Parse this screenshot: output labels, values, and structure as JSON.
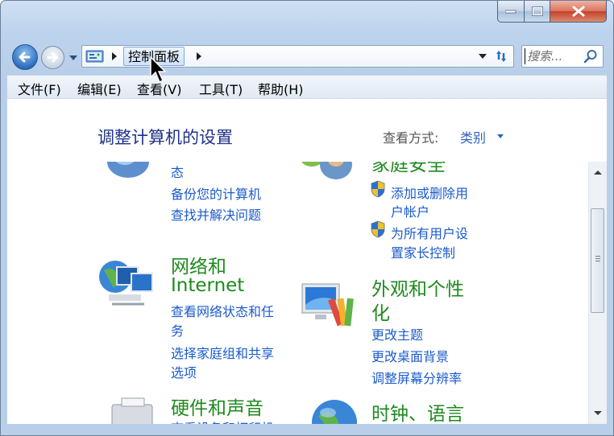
{
  "window": {
    "caption_buttons": [
      "minimize-icon",
      "maximize-icon",
      "close-icon"
    ]
  },
  "address": {
    "breadcrumb": "控制面板",
    "icons": [
      "back-icon",
      "forward-icon",
      "control-panel-icon",
      "refresh-icon"
    ]
  },
  "search": {
    "placeholder": "搜索..."
  },
  "menu": [
    "文件(F)",
    "编辑(E)",
    "查看(V)",
    "工具(T)",
    "帮助(H)"
  ],
  "page": {
    "heading": "调整计算机的设置",
    "view_by_label": "查看方式:",
    "view_by_value": "类别"
  },
  "categories": {
    "system": {
      "links": [
        "态",
        "备份您的计算机",
        "查找并解决问题"
      ]
    },
    "users": {
      "partial_title": "家庭安全",
      "links": [
        "添加或删除用",
        "户帐户",
        "为所有用户设",
        "置家长控制"
      ]
    },
    "network": {
      "title_line1": "网络和",
      "title_line2": "Internet",
      "links": [
        "查看网络状态和任",
        "务",
        "选择家庭组和共享",
        "选项"
      ]
    },
    "appearance": {
      "title_line1": "外观和个性",
      "title_line2": "化",
      "links": [
        "更改主题",
        "更改桌面背景",
        "调整屏幕分辨率"
      ]
    },
    "hardware": {
      "title": "硬件和声音",
      "links": [
        "查看设备和打印机"
      ]
    },
    "clock": {
      "title": "时钟、语言"
    }
  },
  "colors": {
    "link": "#1b5bcc",
    "category_title": "#1e8a1e",
    "heading": "#1e3287"
  }
}
